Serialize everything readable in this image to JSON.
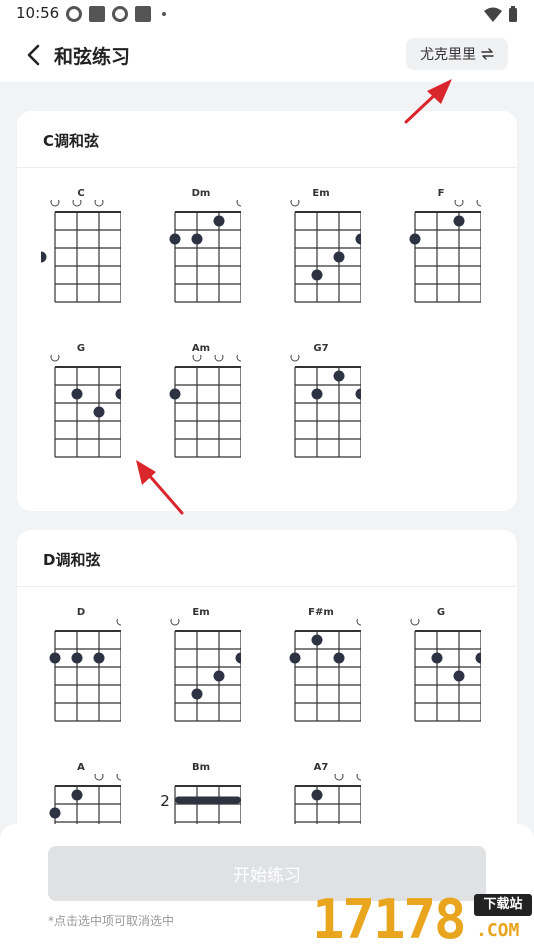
{
  "status": {
    "time": "10:56"
  },
  "nav": {
    "title": "和弦练习",
    "instrument_label": "尤克里里"
  },
  "sections": [
    {
      "title": "C调和弦",
      "chords": [
        {
          "name": "C",
          "open": [
            1,
            1,
            1,
            0
          ],
          "dots": [
            [
              4,
              3
            ]
          ]
        },
        {
          "name": "Dm",
          "open": [
            0,
            0,
            0,
            1
          ],
          "dots": [
            [
              0,
              2
            ],
            [
              1,
              2
            ],
            [
              2,
              1
            ]
          ]
        },
        {
          "name": "Em",
          "open": [
            1,
            0,
            0,
            0
          ],
          "dots": [
            [
              1,
              4
            ],
            [
              2,
              3
            ],
            [
              3,
              2
            ]
          ]
        },
        {
          "name": "F",
          "open": [
            0,
            0,
            1,
            1
          ],
          "dots": [
            [
              0,
              2
            ],
            [
              2,
              1
            ]
          ]
        },
        {
          "name": "G",
          "open": [
            1,
            0,
            0,
            0
          ],
          "dots": [
            [
              1,
              2
            ],
            [
              2,
              3
            ],
            [
              3,
              2
            ]
          ]
        },
        {
          "name": "Am",
          "open": [
            0,
            1,
            1,
            1
          ],
          "dots": [
            [
              0,
              2
            ]
          ]
        },
        {
          "name": "G7",
          "open": [
            1,
            0,
            0,
            0
          ],
          "dots": [
            [
              1,
              2
            ],
            [
              2,
              1
            ],
            [
              3,
              2
            ]
          ]
        }
      ]
    },
    {
      "title": "D调和弦",
      "chords": [
        {
          "name": "D",
          "open": [
            0,
            0,
            0,
            1
          ],
          "dots": [
            [
              0,
              2
            ],
            [
              1,
              2
            ],
            [
              2,
              2
            ]
          ]
        },
        {
          "name": "Em",
          "open": [
            1,
            0,
            0,
            0
          ],
          "dots": [
            [
              1,
              4
            ],
            [
              2,
              3
            ],
            [
              3,
              2
            ]
          ]
        },
        {
          "name": "F#m",
          "open": [
            0,
            0,
            0,
            1
          ],
          "dots": [
            [
              0,
              2
            ],
            [
              1,
              1
            ],
            [
              2,
              2
            ]
          ]
        },
        {
          "name": "G",
          "open": [
            1,
            0,
            0,
            0
          ],
          "dots": [
            [
              1,
              2
            ],
            [
              2,
              3
            ],
            [
              3,
              2
            ]
          ]
        },
        {
          "name": "A",
          "open": [
            0,
            0,
            1,
            1
          ],
          "dots": [
            [
              0,
              2
            ],
            [
              1,
              1
            ]
          ]
        },
        {
          "name": "Bm",
          "open": [
            0,
            0,
            0,
            0
          ],
          "dots": [],
          "barre": {
            "fret": 2,
            "label": "2"
          }
        },
        {
          "name": "A7",
          "open": [
            0,
            0,
            1,
            1
          ],
          "dots": [
            [
              1,
              1
            ]
          ]
        }
      ]
    }
  ],
  "bottom": {
    "start_label": "开始练习",
    "hint": "*点击选中项可取消选中"
  },
  "watermark": {
    "digits": "17178",
    "tag": "下载站",
    "domain": ".COM"
  },
  "colors": {
    "accent_arrow": "#d9262c",
    "dot": "#2e3344",
    "button_disabled": "#dfe1e3",
    "background": "#f2f3f5"
  }
}
